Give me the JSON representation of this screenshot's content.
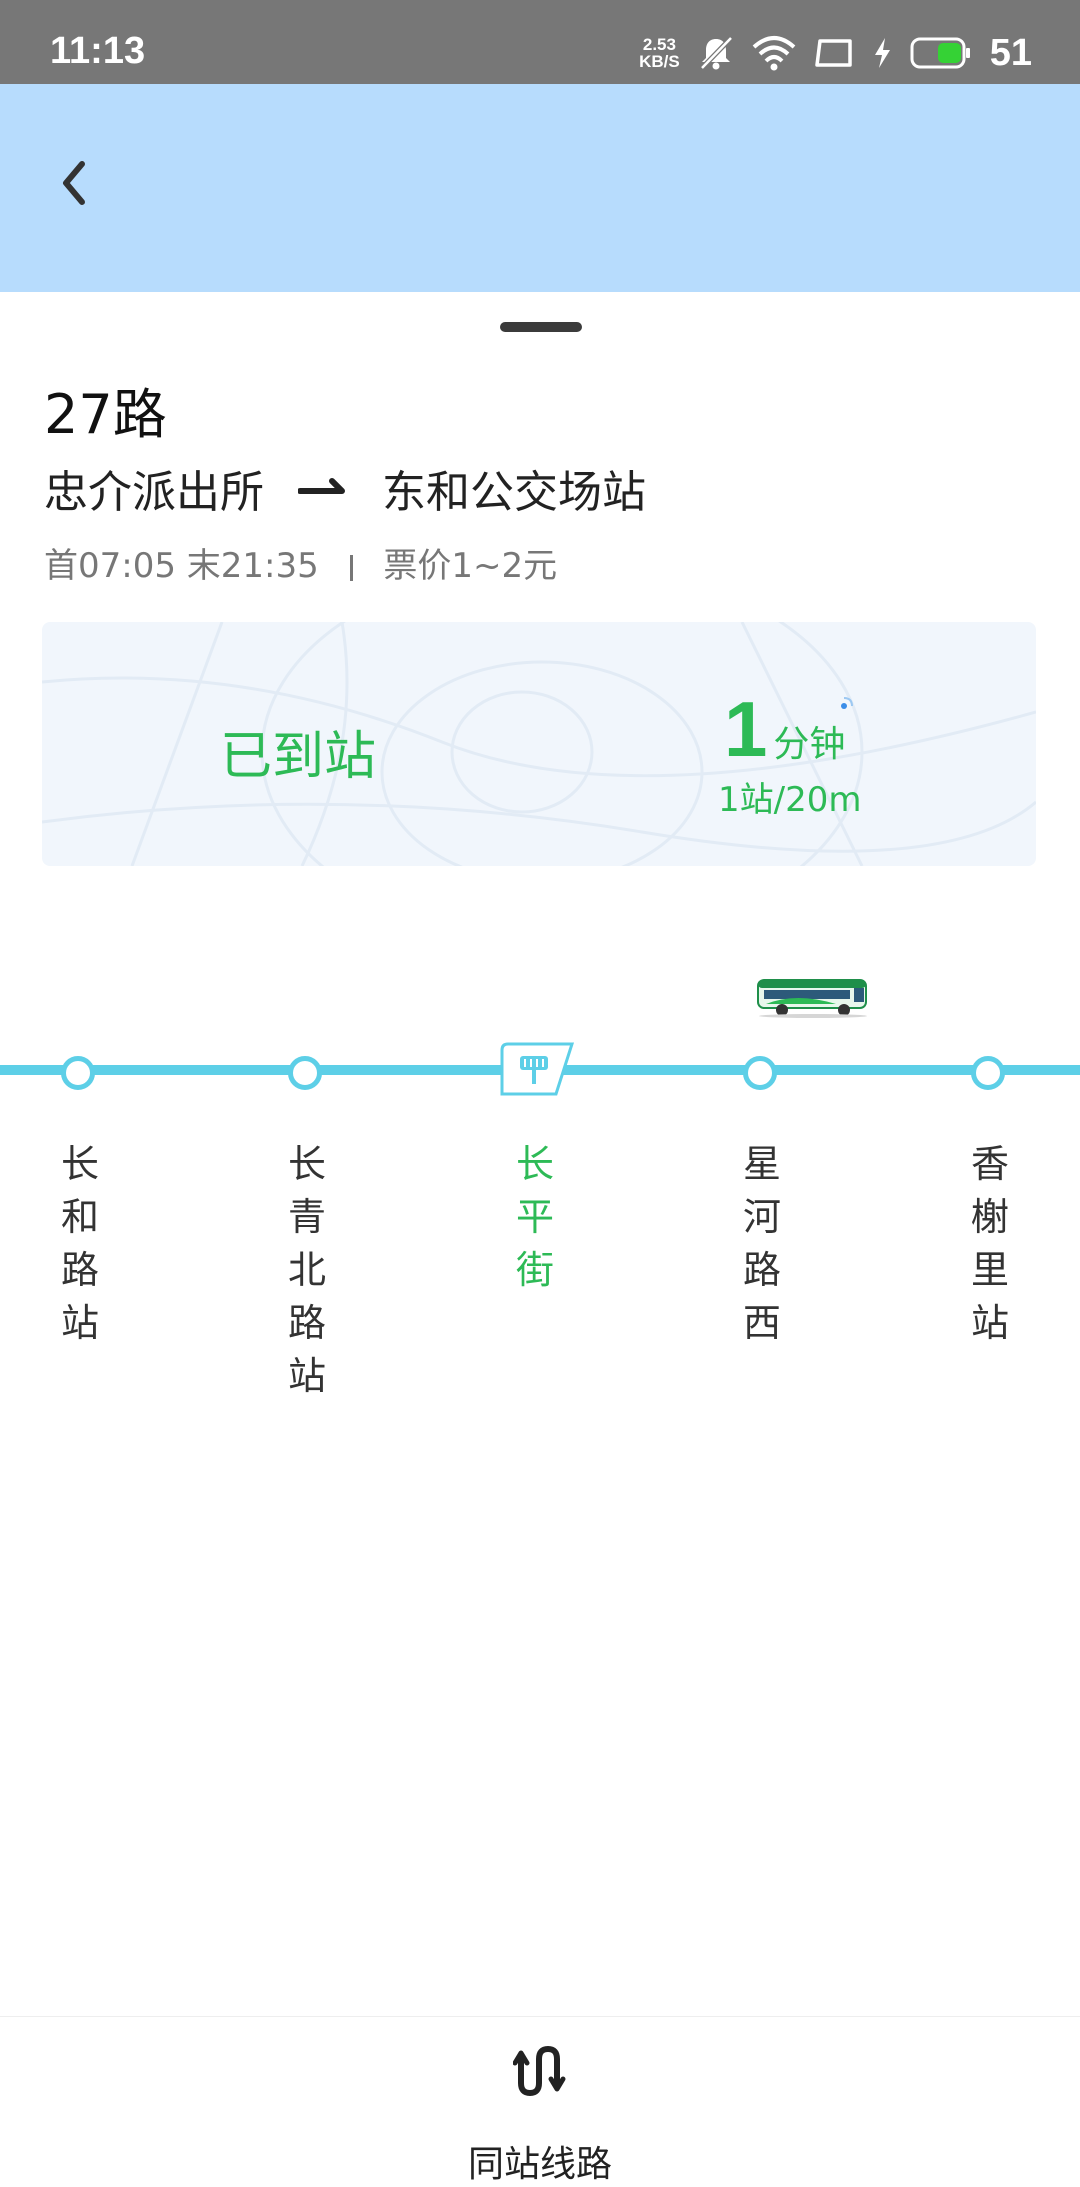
{
  "status_bar": {
    "time": "11:13",
    "net_speed_value": "2.53",
    "net_speed_unit": "KB/S",
    "battery_level": "51",
    "icons": [
      "mute-icon",
      "wifi-icon",
      "screen-icon",
      "charging-icon",
      "battery-icon"
    ]
  },
  "header": {
    "back_icon": "chevron-left-icon",
    "background": "#b7dcfd"
  },
  "route": {
    "name": "27路",
    "from": "忠介派出所",
    "to": "东和公交场站",
    "first_bus": "首07:05",
    "last_bus": "末21:35",
    "fare": "票价1~2元"
  },
  "arrival": {
    "status": "已到站",
    "eta_value": "1",
    "eta_unit": "分钟",
    "distance": "1站/20m",
    "accent": "#2dba56"
  },
  "stops": [
    {
      "name": "长\n和\n路\n站",
      "current": false
    },
    {
      "name": "长\n青\n北\n路\n站",
      "current": false
    },
    {
      "name": "长\n平\n街",
      "current": true
    },
    {
      "name": "星\n河\n路\n西",
      "current": false
    },
    {
      "name": "香\n榭\n里\n站",
      "current": false
    }
  ],
  "line_color": "#5dcfe7",
  "bottom_bar": {
    "same_stop_label": "同站线路",
    "same_stop_icon": "route-loop-icon"
  }
}
